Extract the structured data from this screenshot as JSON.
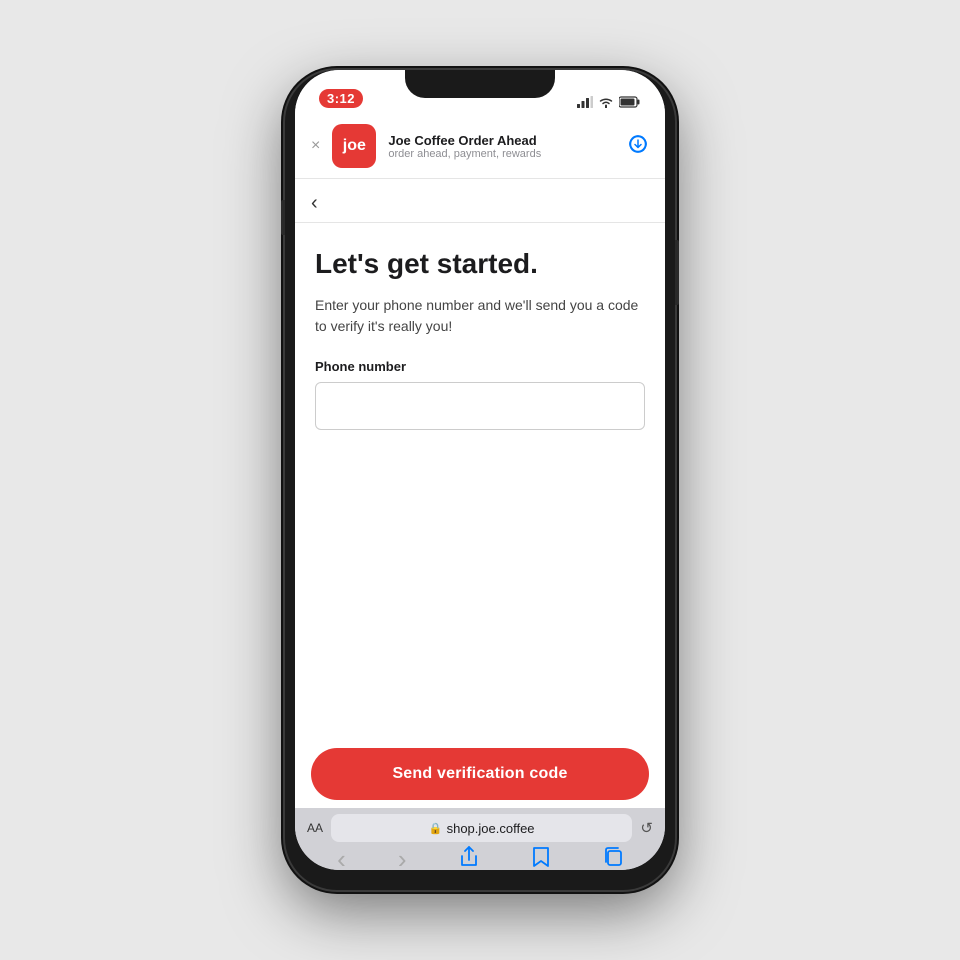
{
  "status_bar": {
    "time": "3:12"
  },
  "app_banner": {
    "close_label": "×",
    "app_icon_text": "joe",
    "app_name": "Joe Coffee Order Ahead",
    "app_desc": "order ahead, payment, rewards",
    "download_icon": "cloud-download"
  },
  "nav": {
    "back_label": "‹"
  },
  "form": {
    "title": "Let's get started.",
    "subtitle": "Enter your phone number and we'll send you a code to verify it's really you!",
    "phone_label": "Phone number",
    "phone_placeholder": "",
    "submit_label": "Send verification code"
  },
  "safari": {
    "aa_label": "AA",
    "lock_icon": "🔒",
    "url": "shop.joe.coffee",
    "reload_icon": "↺"
  },
  "safari_nav": {
    "back": "‹",
    "forward": "›",
    "share": "share",
    "bookmark": "book",
    "tabs": "tabs"
  }
}
